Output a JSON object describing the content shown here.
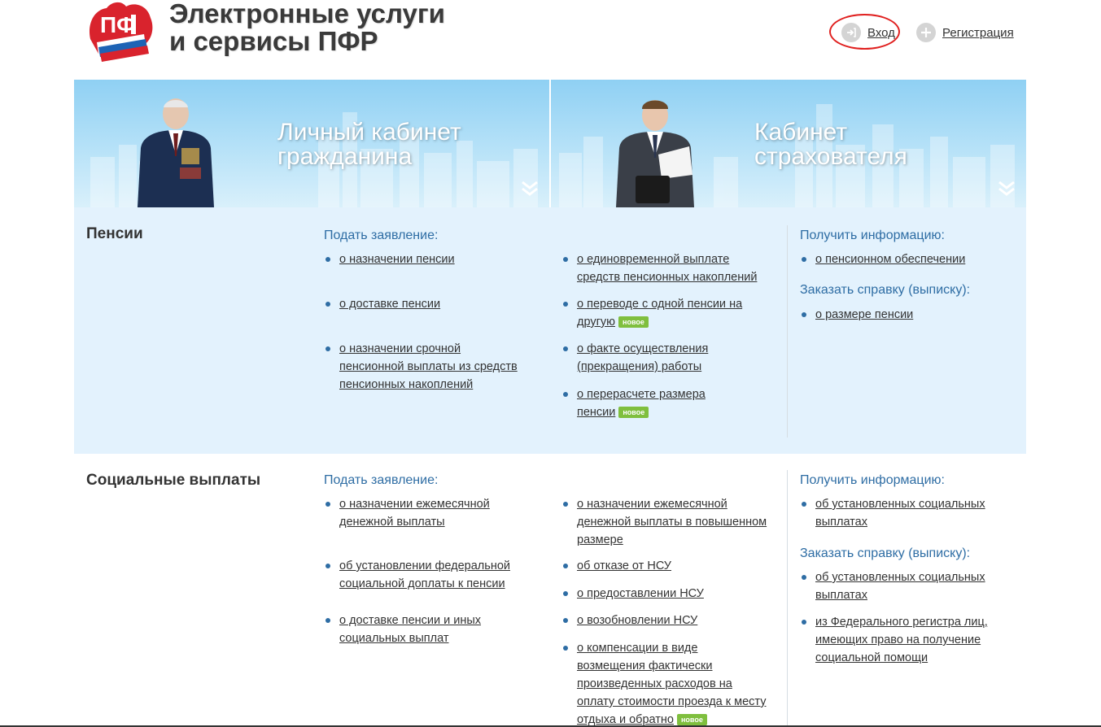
{
  "header": {
    "title_line1": "Электронные услуги",
    "title_line2": "и сервисы ПФР",
    "login_label": "Вход",
    "register_label": "Регистрация",
    "login_icon": "login-arrow-icon",
    "register_icon": "plus-icon"
  },
  "banners": [
    {
      "line1": "Личный кабинет",
      "line2": "гражданина",
      "icon": "double-chevron-down-icon"
    },
    {
      "line1": "Кабинет",
      "line2": "страхователя",
      "icon": "double-chevron-down-icon"
    }
  ],
  "colors": {
    "accent": "#2e6da4",
    "badge": "#7fbf3e",
    "highlight_ring": "#e0201f",
    "section_bg": "#e3f2fd"
  },
  "sections": {
    "pensions": {
      "title": "Пенсии",
      "apply_heading": "Подать заявление:",
      "info_heading": "Получить информацию:",
      "order_heading": "Заказать справку (выписку):",
      "col1": [
        {
          "l1": "о назначении пенсии"
        },
        {
          "l1": "о доставке пенсии"
        },
        {
          "l1": "о назначении срочной",
          "l2": "пенсионной выплаты из средств",
          "l3": "пенсионных накоплений"
        }
      ],
      "col2": [
        {
          "l1": "о единовременной выплате",
          "l2": "средств пенсионных накоплений"
        },
        {
          "l1": "о переводе с одной пенсии на",
          "l2": "другую",
          "badge": "новое"
        },
        {
          "l1": "о факте осуществления",
          "l2": "(прекращения) работы"
        },
        {
          "l1": "о перерасчете размера",
          "l2": "пенсии",
          "badge": "новое"
        }
      ],
      "info": [
        {
          "l1": "о пенсионном обеспечении"
        }
      ],
      "order": [
        {
          "l1": "о размере пенсии"
        }
      ]
    },
    "social": {
      "title": "Социальные выплаты",
      "apply_heading": "Подать заявление:",
      "info_heading": "Получить информацию:",
      "order_heading": "Заказать справку (выписку):",
      "col1": [
        {
          "l1": "о назначении ежемесячной",
          "l2": "денежной выплаты"
        },
        {
          "l1": "об установлении федеральной",
          "l2": "социальной доплаты к пенсии"
        },
        {
          "l1": "о доставке пенсии и иных",
          "l2": "социальных выплат"
        }
      ],
      "col2": [
        {
          "l1": "о назначении ежемесячной",
          "l2": "денежной выплаты в повышенном",
          "l3": "размере"
        },
        {
          "l1": "об отказе от НСУ"
        },
        {
          "l1": "о предоставлении НСУ"
        },
        {
          "l1": "о возобновлении НСУ"
        },
        {
          "l1": "о компенсации в виде",
          "l2": "возмещения фактически",
          "l3": "произведенных расходов на",
          "l4": "оплату стоимости проезда к месту",
          "l5": "отдыха и обратно",
          "badge": "новое"
        }
      ],
      "info": [
        {
          "l1": "об установленных социальных",
          "l2": "выплатах"
        }
      ],
      "order": [
        {
          "l1": "об установленных социальных",
          "l2": "выплатах"
        },
        {
          "l1": "из Федерального регистра лиц,",
          "l2": "имеющих право на получение",
          "l3": "социальной помощи"
        }
      ]
    }
  }
}
